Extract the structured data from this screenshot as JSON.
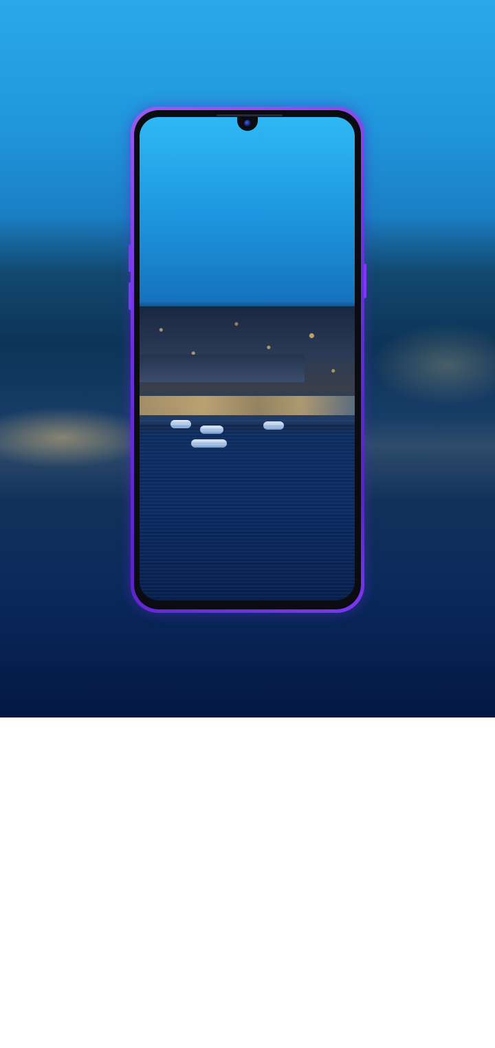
{
  "hero": {
    "image_name": "phone-product-showcase",
    "background_colors": [
      "#29a8ea",
      "#0d3458",
      "#041744"
    ]
  },
  "phone": {
    "frame_color": "#6b2fe0",
    "screen_wallpaper": "night-city-harbor",
    "icons": [
      "front-camera-icon"
    ]
  }
}
